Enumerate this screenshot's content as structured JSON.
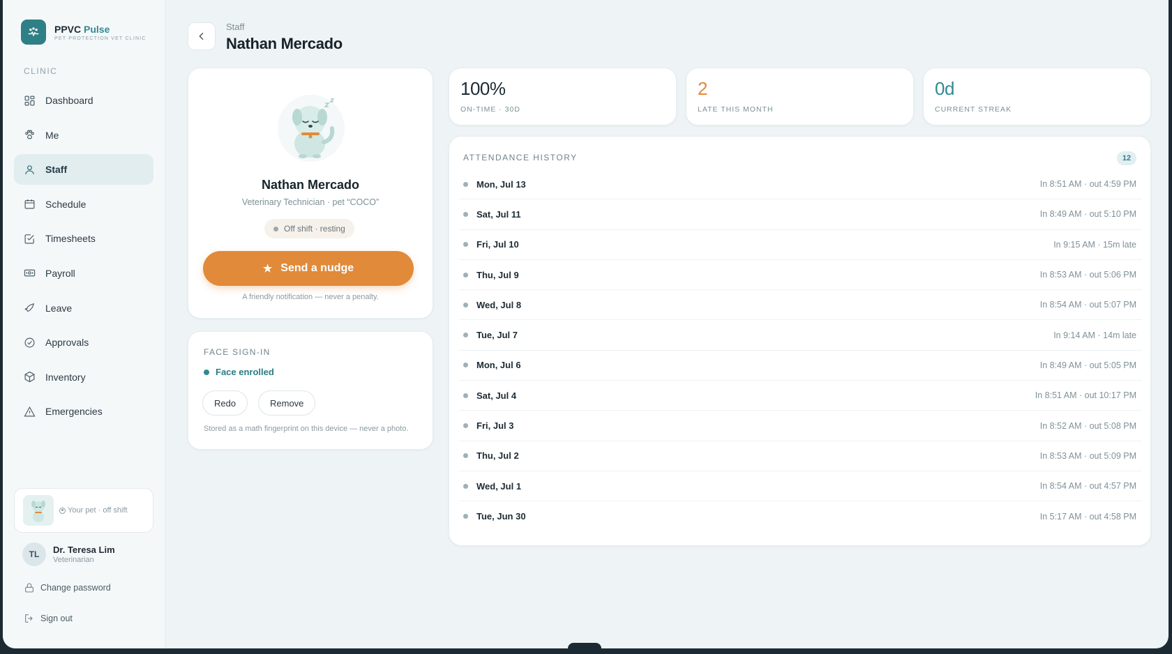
{
  "brand": {
    "name": "PPVC",
    "accent": "Pulse",
    "subtitle": "PET PROTECTION VET CLINIC"
  },
  "sidebar": {
    "section": "CLINIC",
    "items": [
      {
        "label": "Dashboard",
        "icon": "grid-icon",
        "active": false
      },
      {
        "label": "Me",
        "icon": "paw-icon",
        "active": false
      },
      {
        "label": "Staff",
        "icon": "person-icon",
        "active": true
      },
      {
        "label": "Schedule",
        "icon": "calendar-icon",
        "active": false
      },
      {
        "label": "Timesheets",
        "icon": "checkbox-icon",
        "active": false
      },
      {
        "label": "Payroll",
        "icon": "banknote-icon",
        "active": false
      },
      {
        "label": "Leave",
        "icon": "leaf-icon",
        "active": false
      },
      {
        "label": "Approvals",
        "icon": "check-circle-icon",
        "active": false
      },
      {
        "label": "Inventory",
        "icon": "box-icon",
        "active": false
      },
      {
        "label": "Emergencies",
        "icon": "warning-icon",
        "active": false
      }
    ],
    "pet_status": "Your pet · off shift",
    "user": {
      "initials": "TL",
      "name": "Dr. Teresa Lim",
      "role": "Veterinarian"
    },
    "change_password": "Change password",
    "sign_out": "Sign out"
  },
  "header": {
    "breadcrumb": "Staff",
    "title": "Nathan Mercado"
  },
  "profile": {
    "name": "Nathan Mercado",
    "role": "Veterinary Technician · pet “COCO”",
    "status": "Off shift · resting",
    "nudge_label": "Send a nudge",
    "nudge_note": "A friendly notification — never a penalty."
  },
  "face": {
    "title": "FACE SIGN-IN",
    "status": "Face enrolled",
    "redo_label": "Redo",
    "remove_label": "Remove",
    "note": "Stored as a math fingerprint on this device — never a photo."
  },
  "stats": [
    {
      "value": "100%",
      "label": "ON-TIME · 30D",
      "color": "#1c2a33"
    },
    {
      "value": "2",
      "label": "LATE THIS MONTH",
      "color": "#e08a3a"
    },
    {
      "value": "0d",
      "label": "CURRENT STREAK",
      "color": "#2f8a92"
    }
  ],
  "history": {
    "title": "ATTENDANCE HISTORY",
    "count": "12",
    "rows": [
      {
        "date": "Mon, Jul 13",
        "time": "In 8:51 AM · out 4:59 PM"
      },
      {
        "date": "Sat, Jul 11",
        "time": "In 8:49 AM · out 5:10 PM"
      },
      {
        "date": "Fri, Jul 10",
        "time": "In 9:15 AM · 15m late"
      },
      {
        "date": "Thu, Jul 9",
        "time": "In 8:53 AM · out 5:06 PM"
      },
      {
        "date": "Wed, Jul 8",
        "time": "In 8:54 AM · out 5:07 PM"
      },
      {
        "date": "Tue, Jul 7",
        "time": "In 9:14 AM · 14m late"
      },
      {
        "date": "Mon, Jul 6",
        "time": "In 8:49 AM · out 5:05 PM"
      },
      {
        "date": "Sat, Jul 4",
        "time": "In 8:51 AM · out 10:17 PM"
      },
      {
        "date": "Fri, Jul 3",
        "time": "In 8:52 AM · out 5:08 PM"
      },
      {
        "date": "Thu, Jul 2",
        "time": "In 8:53 AM · out 5:09 PM"
      },
      {
        "date": "Wed, Jul 1",
        "time": "In 8:54 AM · out 4:57 PM"
      },
      {
        "date": "Tue, Jun 30",
        "time": "In 5:17 AM · out 4:58 PM"
      }
    ]
  }
}
